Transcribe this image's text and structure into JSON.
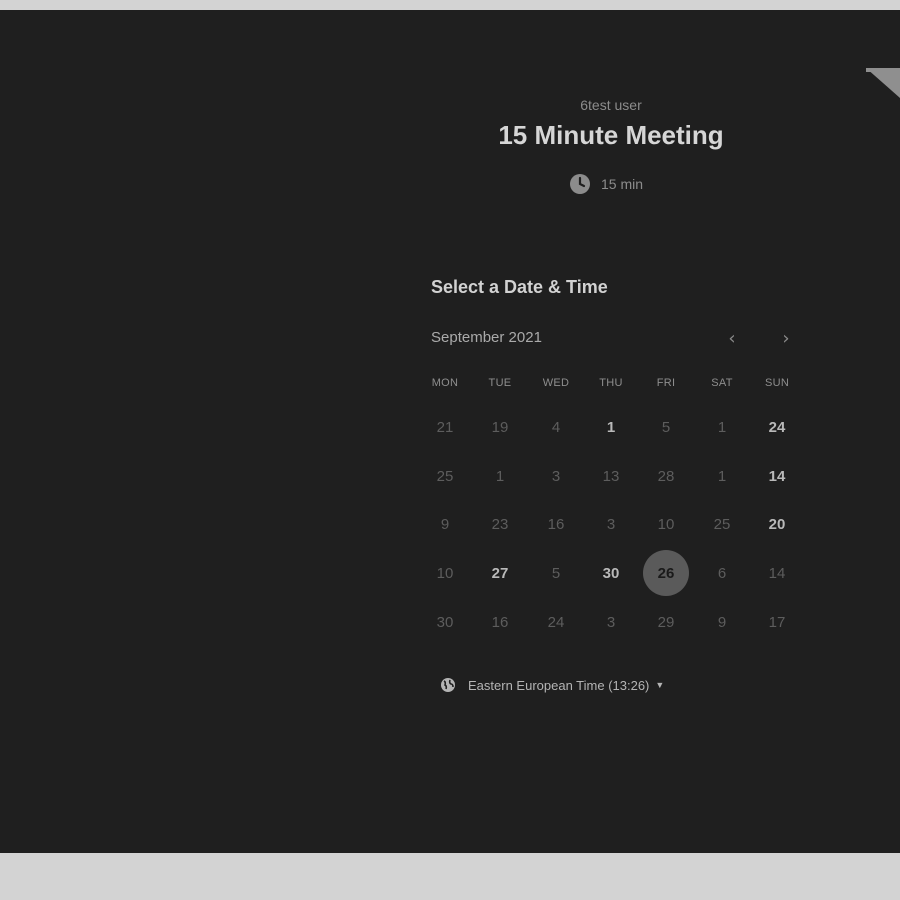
{
  "event": {
    "owner": "6test user",
    "title": "15 Minute Meeting",
    "duration": "15 min"
  },
  "calendar": {
    "heading": "Select a Date & Time",
    "month": "September 2021",
    "prev_icon": "chevron-left-icon",
    "next_icon": "chevron-right-icon",
    "weekdays": [
      "MON",
      "TUE",
      "WED",
      "THU",
      "FRI",
      "SAT",
      "SUN"
    ],
    "weeks": [
      [
        "21",
        "19",
        "4",
        "1",
        "5",
        "1",
        "24"
      ],
      [
        "25",
        "1",
        "3",
        "13",
        "28",
        "1",
        "14"
      ],
      [
        "9",
        "23",
        "16",
        "3",
        "10",
        "25",
        "20"
      ],
      [
        "10",
        "27",
        "5",
        "30",
        "26",
        "6",
        "14"
      ],
      [
        "30",
        "16",
        "24",
        "3",
        "29",
        "9",
        "17"
      ]
    ],
    "available": [
      [
        0,
        3
      ],
      [
        0,
        6
      ],
      [
        1,
        6
      ],
      [
        2,
        6
      ],
      [
        3,
        1
      ],
      [
        3,
        3
      ]
    ],
    "selected": [
      3,
      4
    ]
  },
  "timezone": {
    "label": "Eastern European Time (13:26)",
    "icon": "globe-icon"
  },
  "colors": {
    "background": "#1f1f1f",
    "frame": "#d3d3d3",
    "selected_day": "#5a5a5a"
  }
}
